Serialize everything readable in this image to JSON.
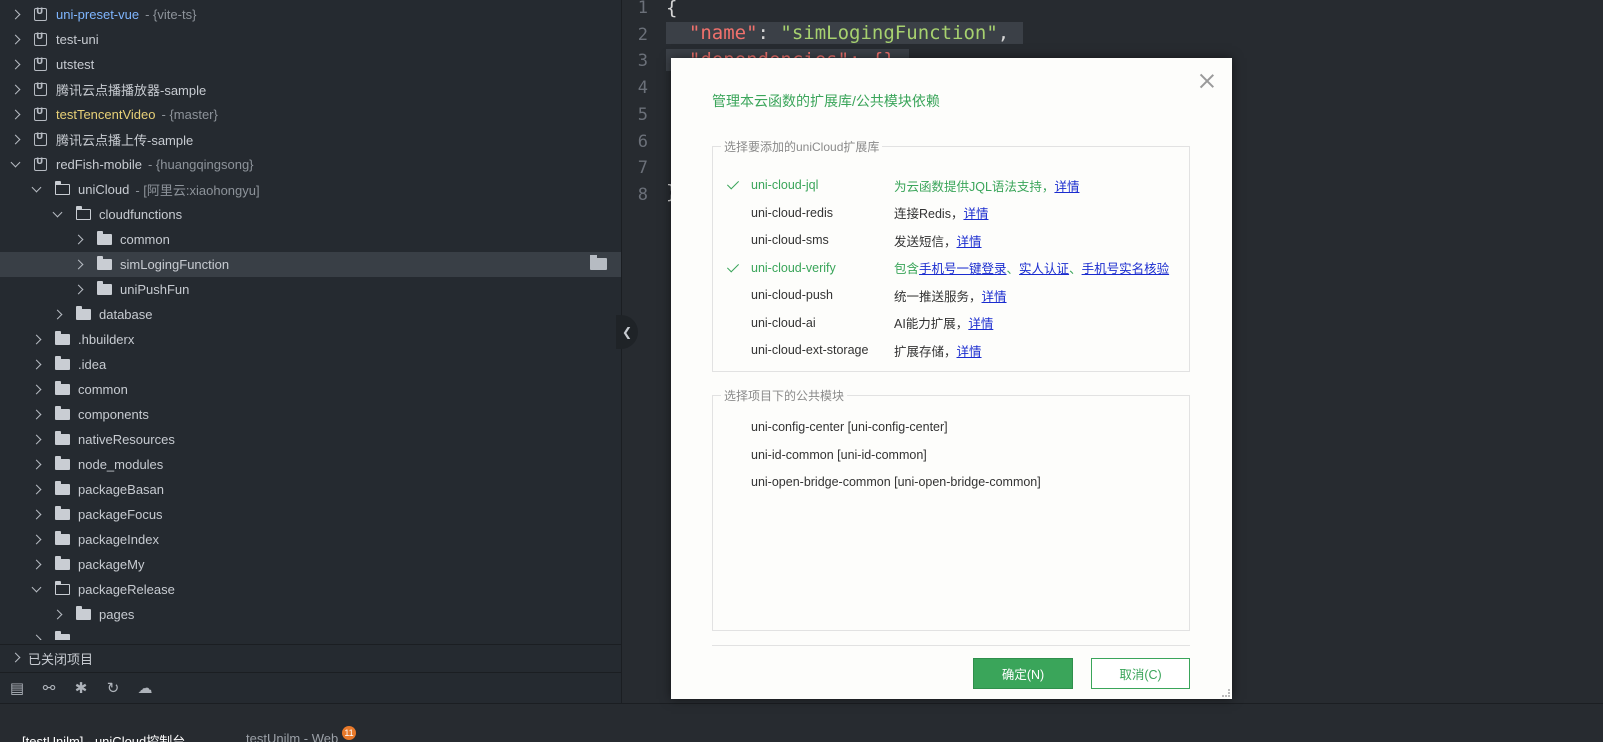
{
  "sidebar": {
    "tree": [
      {
        "name": "uni-preset-vue",
        "meta": "- {vite-ts}",
        "kind": "project",
        "style": "blue"
      },
      {
        "name": "test-uni",
        "meta": "",
        "kind": "project",
        "style": ""
      },
      {
        "name": "utstest",
        "meta": "",
        "kind": "project",
        "style": ""
      },
      {
        "name": "腾讯云点播播放器-sample",
        "meta": "",
        "kind": "project",
        "style": ""
      },
      {
        "name": "testTencentVideo",
        "meta": "- {master}",
        "kind": "project",
        "style": "yellow"
      },
      {
        "name": "腾讯云点播上传-sample",
        "meta": "",
        "kind": "project",
        "style": ""
      },
      {
        "name": "redFish-mobile",
        "meta": "- {huangqingsong}",
        "kind": "project",
        "style": "",
        "open": true
      },
      {
        "name": "uniCloud",
        "meta": "- [阿里云:xiaohongyu]",
        "kind": "folder-cloud",
        "open": true
      },
      {
        "name": "cloudfunctions",
        "meta": "",
        "kind": "folder",
        "open": true
      },
      {
        "name": "common",
        "meta": "",
        "kind": "folder"
      },
      {
        "name": "simLogingFunction",
        "meta": "",
        "kind": "folder",
        "selected": true
      },
      {
        "name": "uniPushFun",
        "meta": "",
        "kind": "folder"
      },
      {
        "name": "database",
        "meta": "",
        "kind": "folder"
      },
      {
        "name": ".hbuilderx",
        "meta": "",
        "kind": "folder"
      },
      {
        "name": ".idea",
        "meta": "",
        "kind": "folder"
      },
      {
        "name": "common",
        "meta": "",
        "kind": "folder"
      },
      {
        "name": "components",
        "meta": "",
        "kind": "folder"
      },
      {
        "name": "nativeResources",
        "meta": "",
        "kind": "folder"
      },
      {
        "name": "node_modules",
        "meta": "",
        "kind": "folder"
      },
      {
        "name": "packageBasan",
        "meta": "",
        "kind": "folder"
      },
      {
        "name": "packageFocus",
        "meta": "",
        "kind": "folder"
      },
      {
        "name": "packageIndex",
        "meta": "",
        "kind": "folder"
      },
      {
        "name": "packageMy",
        "meta": "",
        "kind": "folder"
      },
      {
        "name": "packageRelease",
        "meta": "",
        "kind": "folder",
        "open": true
      },
      {
        "name": "pages",
        "meta": "",
        "kind": "folder"
      },
      {
        "name": "",
        "meta": "",
        "kind": "folder"
      }
    ],
    "closed_projects_label": "已关闭项目",
    "toolbar_icons": [
      "project-explorer-icon",
      "binoculars-icon",
      "bug-icon",
      "refresh-icon",
      "cloud-icon"
    ]
  },
  "editor": {
    "line_numbers": [
      "1",
      "2",
      "3",
      "4",
      "5",
      "6",
      "7",
      "8"
    ],
    "line1": "{",
    "line2_key": "\"name\"",
    "line2_colon": ": ",
    "line2_value": "\"simLogingFunction\"",
    "line2_comma": ",",
    "line3_fragment": "\"dependencies\": {}",
    "line8": "}"
  },
  "bottom_tabs": {
    "console": "[testUnilm] - uniCloud控制台",
    "web": "testUnilm - Web",
    "badge": "11"
  },
  "dialog": {
    "title": "管理本云函数的扩展库/公共模块依赖",
    "ext_legend": "选择要添加的uniCloud扩展库",
    "extensions": [
      {
        "name": "uni-cloud-jql",
        "checked": true,
        "desc_pre": "为云函数提供JQL语法支持，",
        "links": [
          "详情"
        ]
      },
      {
        "name": "uni-cloud-redis",
        "checked": false,
        "desc_pre": "连接Redis，",
        "links": [
          "详情"
        ]
      },
      {
        "name": "uni-cloud-sms",
        "checked": false,
        "desc_pre": "发送短信，",
        "links": [
          "详情"
        ]
      },
      {
        "name": "uni-cloud-verify",
        "checked": true,
        "desc_pre": "包含",
        "links": [
          "手机号一键登录",
          "实人认证",
          "手机号实名核验"
        ]
      },
      {
        "name": "uni-cloud-push",
        "checked": false,
        "desc_pre": "统一推送服务，",
        "links": [
          "详情"
        ]
      },
      {
        "name": "uni-cloud-ai",
        "checked": false,
        "desc_pre": "AI能力扩展，",
        "links": [
          "详情"
        ]
      },
      {
        "name": "uni-cloud-ext-storage",
        "checked": false,
        "desc_pre": "扩展存储，",
        "links": [
          "详情"
        ]
      }
    ],
    "modules_legend": "选择项目下的公共模块",
    "modules": [
      "uni-config-center [uni-config-center]",
      "uni-id-common [uni-id-common]",
      "uni-open-bridge-common [uni-open-bridge-common]"
    ],
    "ok_label": "确定(N)",
    "cancel_label": "取消(C)",
    "accent_color": "#3aa55a",
    "link_color": "#1a2ccf"
  }
}
